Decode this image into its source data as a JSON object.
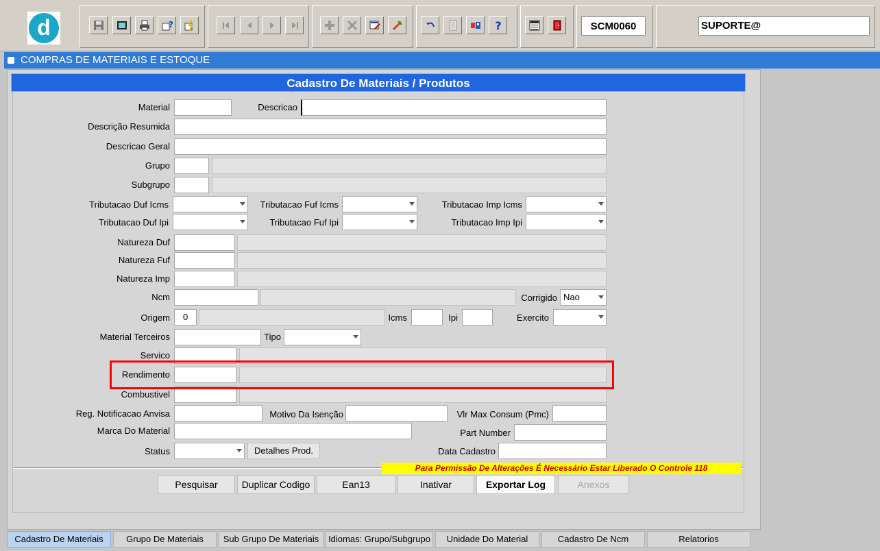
{
  "toolbar": {
    "logo_letter": "d",
    "form_code": "SCM0060",
    "user": "SUPORTE@",
    "buttons": [
      {
        "name": "save-icon"
      },
      {
        "name": "window-icon"
      },
      {
        "name": "print-icon"
      },
      {
        "name": "query-icon"
      },
      {
        "name": "execute-query-icon"
      },
      {
        "name": "first-record-icon"
      },
      {
        "name": "previous-record-icon"
      },
      {
        "name": "next-record-icon"
      },
      {
        "name": "last-record-icon"
      },
      {
        "name": "insert-record-icon"
      },
      {
        "name": "delete-record-icon"
      },
      {
        "name": "edit-record-icon"
      },
      {
        "name": "clear-record-icon"
      },
      {
        "name": "undo-icon"
      },
      {
        "name": "list-values-icon"
      },
      {
        "name": "keys-icon"
      },
      {
        "name": "help-icon"
      },
      {
        "name": "menu-icon"
      },
      {
        "name": "exit-icon"
      }
    ]
  },
  "module": {
    "title": "COMPRAS DE MATERIAIS E ESTOQUE"
  },
  "form": {
    "title": "Cadastro De Materiais / Produtos",
    "labels": {
      "material": "Material",
      "descricao": "Descricao",
      "descricao_resumida": "Descrição Resumida",
      "descricao_geral": "Descricao Geral",
      "grupo": "Grupo",
      "subgrupo": "Subgrupo",
      "trib_duf_icms": "Tributacao Duf Icms",
      "trib_fuf_icms": "Tributacao Fuf Icms",
      "trib_imp_icms": "Tributacao Imp Icms",
      "trib_duf_ipi": "Tributacao Duf Ipi",
      "trib_fuf_ipi": "Tributacao Fuf Ipi",
      "trib_imp_ipi": "Tributacao Imp Ipi",
      "natureza_duf": "Natureza Duf",
      "natureza_fuf": "Natureza Fuf",
      "natureza_imp": "Natureza Imp",
      "ncm": "Ncm",
      "corrigido": "Corrigido",
      "origem": "Origem",
      "icms": "Icms",
      "ipi": "Ipi",
      "exercito": "Exercito",
      "material_terceiros": "Material Terceiros",
      "tipo": "Tipo",
      "servico": "Servico",
      "rendimento": "Rendimento",
      "combustivel": "Combustivel",
      "reg_anvisa": "Reg. Notificacao Anvisa",
      "motivo_isencao": "Motivo Da Isenção",
      "vlr_max": "Vlr Max Consum (Pmc)",
      "marca": "Marca Do Material",
      "part_number": "Part Number",
      "status": "Status",
      "data_cadastro": "Data Cadastro"
    },
    "values": {
      "corrigido": "Nao",
      "origem": "0"
    },
    "detalhes_button": "Detalhes Prod.",
    "warning": "Para Permissão De Alterações É Necessário Estar Liberado O Controle 118"
  },
  "actions": {
    "pesquisar": "Pesquisar",
    "duplicar": "Duplicar Codigo",
    "ean13": "Ean13",
    "inativar": "Inativar",
    "exportar": "Exportar Log",
    "anexos": "Anexos"
  },
  "tabs": [
    {
      "label": "Cadastro De Materiais",
      "active": true
    },
    {
      "label": "Grupo De Materiais",
      "active": false
    },
    {
      "label": "Sub Grupo De Materiais",
      "active": false
    },
    {
      "label": "Idiomas: Grupo/Subgrupo",
      "active": false
    },
    {
      "label": "Unidade Do Material",
      "active": false
    },
    {
      "label": "Cadastro De Ncm",
      "active": false
    },
    {
      "label": "Relatorios",
      "active": false
    }
  ],
  "colors": {
    "accent": "#1f66e0",
    "module_bar": "#2f7bd6",
    "highlight": "#ff0000",
    "warning_bg": "#ffff00",
    "warning_text": "#d20000"
  }
}
